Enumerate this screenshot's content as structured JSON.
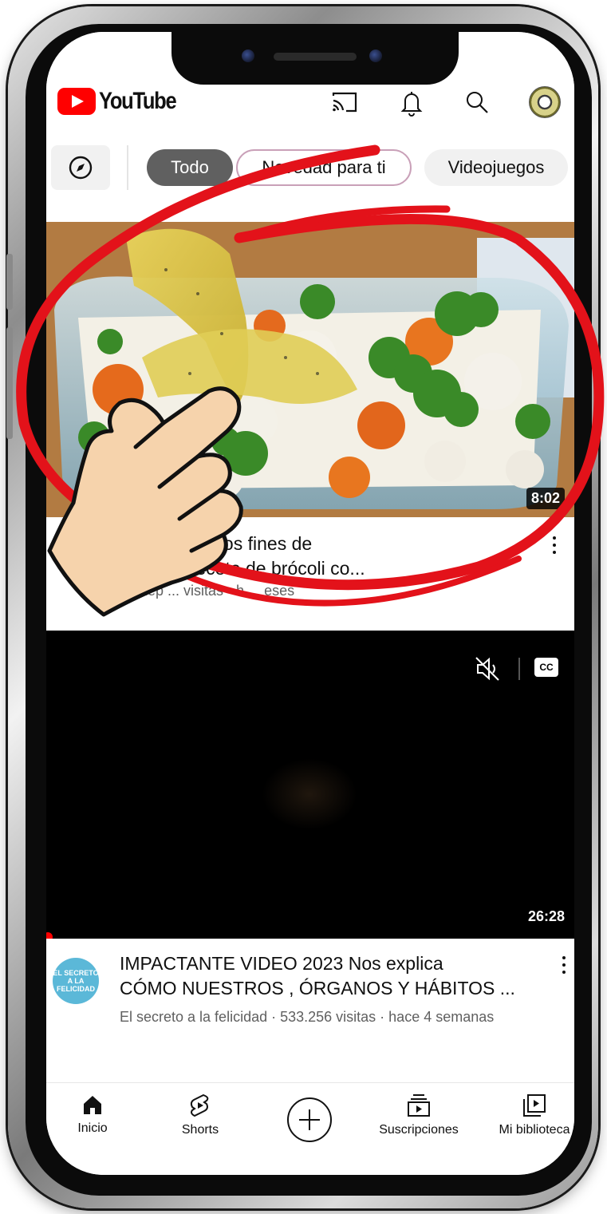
{
  "header": {
    "logo_text": "YouTube",
    "icons": [
      "cast-icon",
      "notification-bell-icon",
      "search-icon",
      "account-avatar"
    ]
  },
  "chips": {
    "explore_icon": "compass-icon",
    "items": [
      "Todo",
      "Novedad para ti",
      "Videojuegos"
    ],
    "selected": "Todo",
    "visible_partial": "ovedad para ti"
  },
  "video1": {
    "duration": "8:02",
    "title_line1": "azuela todos los fines de",
    "title_line2": "Deliciosa receta de brócoli co...",
    "subtitle": "e Rezep ... visitas · h ... eses"
  },
  "video2": {
    "duration": "26:28",
    "channel_avatar_text": "EL SECRETO A LA FELICIDAD",
    "title_line1": "IMPACTANTE VIDEO 2023 Nos explica",
    "title_line2": "CÓMO NUESTROS , ÓRGANOS Y HÁBITOS ...",
    "subtitle": "El secreto a la felicidad · 533.256 visitas · hace 4 semanas",
    "player_icons": [
      "mute-icon",
      "closed-captions-icon"
    ]
  },
  "nav": {
    "items": [
      {
        "label": "Inicio",
        "icon": "home-icon"
      },
      {
        "label": "Shorts",
        "icon": "shorts-icon"
      },
      {
        "label": "",
        "icon": "create-icon"
      },
      {
        "label": "Suscripciones",
        "icon": "subscriptions-icon"
      },
      {
        "label": "Mi biblioteca",
        "icon": "library-icon"
      }
    ]
  },
  "colors": {
    "brand_red": "#ff0000",
    "annotation_red": "#e3121a",
    "chip_selected": "#606060",
    "text_primary": "#0f0f0f",
    "text_secondary": "#606060"
  }
}
